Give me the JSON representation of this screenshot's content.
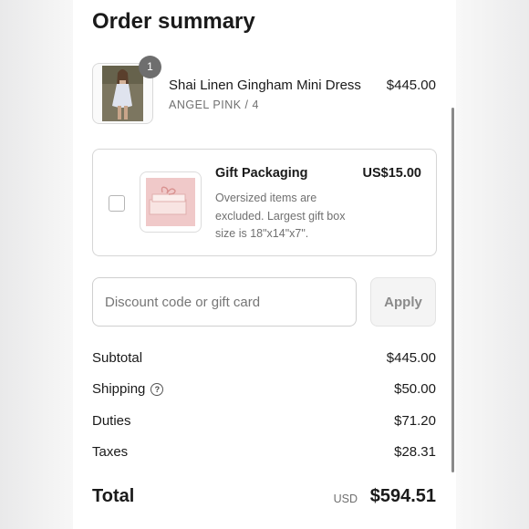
{
  "page": {
    "title": "Order summary"
  },
  "item": {
    "name": "Shai Linen Gingham Mini Dress",
    "variant": "ANGEL PINK / 4",
    "price": "$445.00",
    "quantity": "1"
  },
  "gift": {
    "title": "Gift Packaging",
    "price": "US$15.00",
    "description": "Oversized items are excluded. Largest gift box size is 18\"x14\"x7\".",
    "checked": false
  },
  "discount": {
    "placeholder": "Discount code or gift card",
    "value": "",
    "apply_label": "Apply"
  },
  "summary": {
    "subtotal_label": "Subtotal",
    "subtotal_value": "$445.00",
    "shipping_label": "Shipping",
    "shipping_value": "$50.00",
    "shipping_help": "?",
    "duties_label": "Duties",
    "duties_value": "$71.20",
    "taxes_label": "Taxes",
    "taxes_value": "$28.31"
  },
  "total": {
    "label": "Total",
    "currency": "USD",
    "value": "$594.51"
  },
  "icons": {
    "help": "question-circle-icon"
  }
}
